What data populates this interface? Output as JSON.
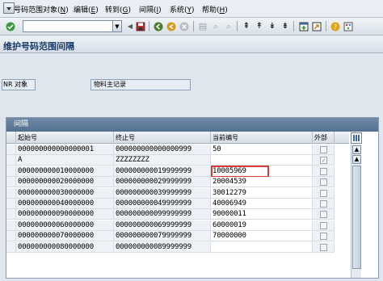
{
  "menu": {
    "items": [
      {
        "label": "号码范围对象(",
        "key": "N",
        "suffix": ")"
      },
      {
        "label": "编辑(",
        "key": "E",
        "suffix": ")"
      },
      {
        "label": "转到(",
        "key": "G",
        "suffix": ")"
      },
      {
        "label": "间隔(",
        "key": "I",
        "suffix": ")"
      },
      {
        "label": "系统(",
        "key": "Y",
        "suffix": ")"
      },
      {
        "label": "帮助(",
        "key": "H",
        "suffix": ")"
      }
    ]
  },
  "toolbar": {
    "command_value": "",
    "icons": [
      "enter-icon",
      "save-icon",
      "back-icon",
      "exit-icon",
      "cancel-icon",
      "print-icon",
      "find-icon",
      "find-next-icon",
      "first-page-icon",
      "previous-page-icon",
      "next-page-icon",
      "last-page-icon",
      "create-session-icon",
      "shortcut-icon",
      "help-icon",
      "customize-layout-icon"
    ]
  },
  "page": {
    "title": "维护号码范围间隔"
  },
  "object": {
    "nr_label": "NR 对象",
    "nr_value": "物料主记录"
  },
  "table": {
    "caption": "间隔",
    "headers": {
      "from": "起始号",
      "to": "终止号",
      "current": "当前编号",
      "external": "外部"
    },
    "rows": [
      {
        "from": "000000000000000001",
        "to": "000000000000000999",
        "current": "50",
        "external": false
      },
      {
        "from": "A",
        "to": "ZZZZZZZZ",
        "current": "",
        "external": true
      },
      {
        "from": "000000000010000000",
        "to": "000000000019999999",
        "current": "10005969",
        "external": false
      },
      {
        "from": "000000000020000000",
        "to": "000000000029999999",
        "current": "20004539",
        "external": false
      },
      {
        "from": "000000000030000000",
        "to": "000000000039999999",
        "current": "30012279",
        "external": false
      },
      {
        "from": "000000000040000000",
        "to": "000000000049999999",
        "current": "40006949",
        "external": false
      },
      {
        "from": "000000000090000000",
        "to": "000000000099999999",
        "current": "90000011",
        "external": false
      },
      {
        "from": "000000000060000000",
        "to": "000000000069999999",
        "current": "60000019",
        "external": false
      },
      {
        "from": "000000000070000000",
        "to": "000000000079999999",
        "current": "70000000",
        "external": false
      },
      {
        "from": "000000000080000000",
        "to": "000000000089999999",
        "current": "",
        "external": false
      }
    ]
  },
  "colors": {
    "title": "#1a3a66",
    "caption_bg": "#5f7a9a",
    "highlight": "#d63a3a"
  }
}
